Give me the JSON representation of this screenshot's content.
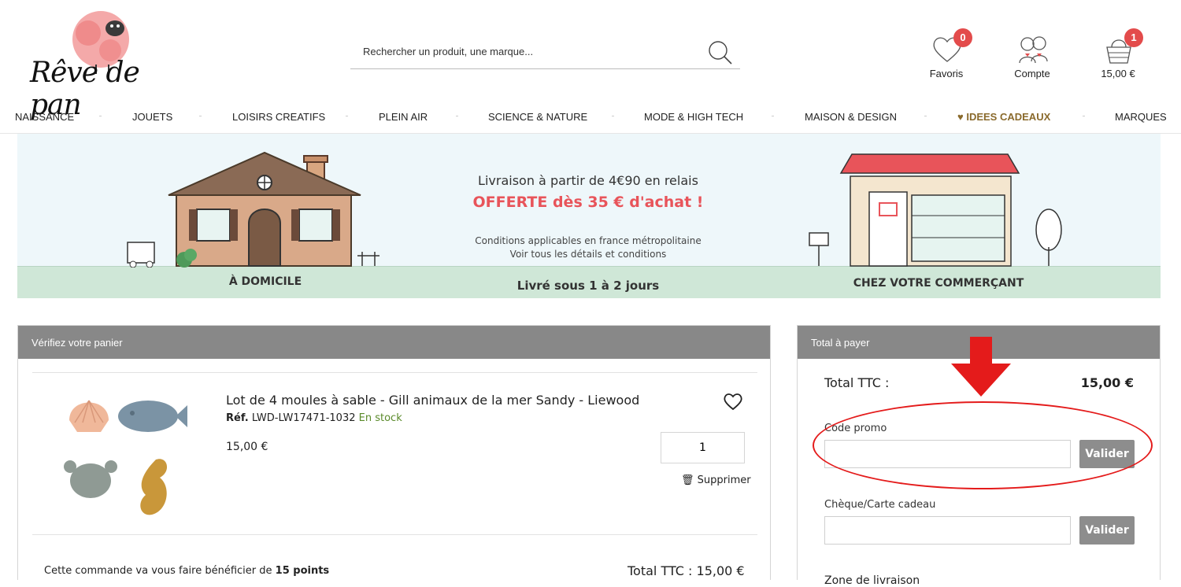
{
  "brand": {
    "name": "Rêve de Pan",
    "logo_text": "Rêve de pan",
    "accent_color": "#e34b4b"
  },
  "search": {
    "placeholder": "Rechercher un produit, une marque..."
  },
  "header_actions": {
    "favorites": {
      "label": "Favoris",
      "count": "0"
    },
    "account": {
      "label": "Compte"
    },
    "cart": {
      "label": "15,00 €",
      "count": "1"
    }
  },
  "nav": {
    "items": [
      "NAISSANCE",
      "JOUETS",
      "LOISIRS CREATIFS",
      "PLEIN AIR",
      "SCIENCE & NATURE",
      "MODE & HIGH TECH",
      "MAISON & DESIGN",
      "IDEES CADEAUX",
      "MARQUES"
    ]
  },
  "banner": {
    "left_label": "À DOMICILE",
    "headline": "Livraison à partir de 4€90 en relais",
    "offer": "OFFERTE dès 35 € d'achat !",
    "conditions_1": "Conditions applicables en france métropolitaine",
    "conditions_2": "Voir tous les détails et conditions",
    "delivery_time": "Livré sous 1 à 2 jours",
    "right_label": "CHEZ VOTRE COMMERÇANT"
  },
  "cart": {
    "heading": "Vérifiez votre panier",
    "product": {
      "name": "Lot de 4 moules à sable - Gill animaux de la mer Sandy - Liewood",
      "ref_label": "Réf.",
      "ref": "LWD-LW17471-1032",
      "stock": "En stock",
      "price": "15,00 €",
      "quantity": "1",
      "delete_label": "Supprimer"
    },
    "points_text": "Cette commande va vous faire bénéficier de",
    "points_value": "15 points",
    "total_text": "Total TTC : 15,00 €"
  },
  "summary": {
    "heading": "Total à payer",
    "total_label": "Total TTC :",
    "total_value": "15,00 €",
    "promo_label": "Code promo",
    "promo_button": "Valider",
    "gift_label": "Chèque/Carte cadeau",
    "gift_button": "Valider",
    "zone_label": "Zone de livraison"
  }
}
